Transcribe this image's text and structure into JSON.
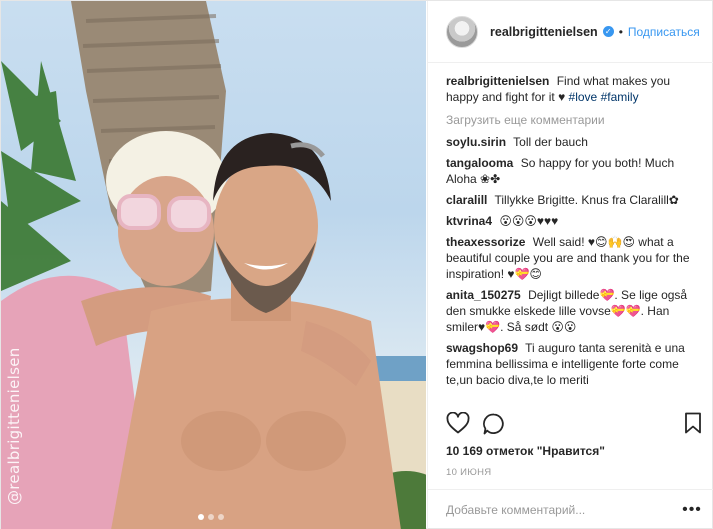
{
  "photo": {
    "watermark": "@realbrigittenielsen",
    "carousel_dots": 3,
    "active_dot": 0
  },
  "header": {
    "username": "realbrigittenielsen",
    "separator": "•",
    "follow_label": "Подписаться"
  },
  "caption": {
    "username": "realbrigittenielsen",
    "text": "Find what makes you happy and fight for it ♥",
    "hashtags": [
      "#love",
      "#family"
    ]
  },
  "load_more": "Загрузить еще комментарии",
  "comments": [
    {
      "user": "soylu.sirin",
      "text": "Toll der bauch"
    },
    {
      "user": "tangalooma",
      "text": "So happy for you both! Much Aloha ❀✤"
    },
    {
      "user": "claralill",
      "text": "Tillykke Brigitte. Knus fra Claralill✿"
    },
    {
      "user": "ktvrina4",
      "text": "😮😮😮♥♥♥"
    },
    {
      "user": "theaxessorize",
      "text": "Well said! ♥😊🙌😍 what a beautiful couple you are and thank you for the inspiration! ♥💝😊"
    },
    {
      "user": "anita_150275",
      "text": "Dejligt billede💝. Se lige også den smukke elskede lille vovse💝💝. Han smiler♥💝. Så sødt 😮😮"
    },
    {
      "user": "swagshop69",
      "text": "Ti auguro tanta serenità e una femmina bellissima e intelligente forte come te,un bacio diva,te lo meriti"
    }
  ],
  "actions": {
    "like_icon": "heart-outline-icon",
    "comment_icon": "speech-bubble-icon",
    "save_icon": "bookmark-outline-icon"
  },
  "likes": "10 169 отметок \"Нравится\"",
  "date": "10 ИЮНЯ",
  "add_comment": {
    "placeholder": "Добавьте комментарий...",
    "more_label": "•••"
  },
  "colors": {
    "link": "#3897f0",
    "hashtag": "#003569",
    "muted": "#999999",
    "text": "#262626"
  }
}
